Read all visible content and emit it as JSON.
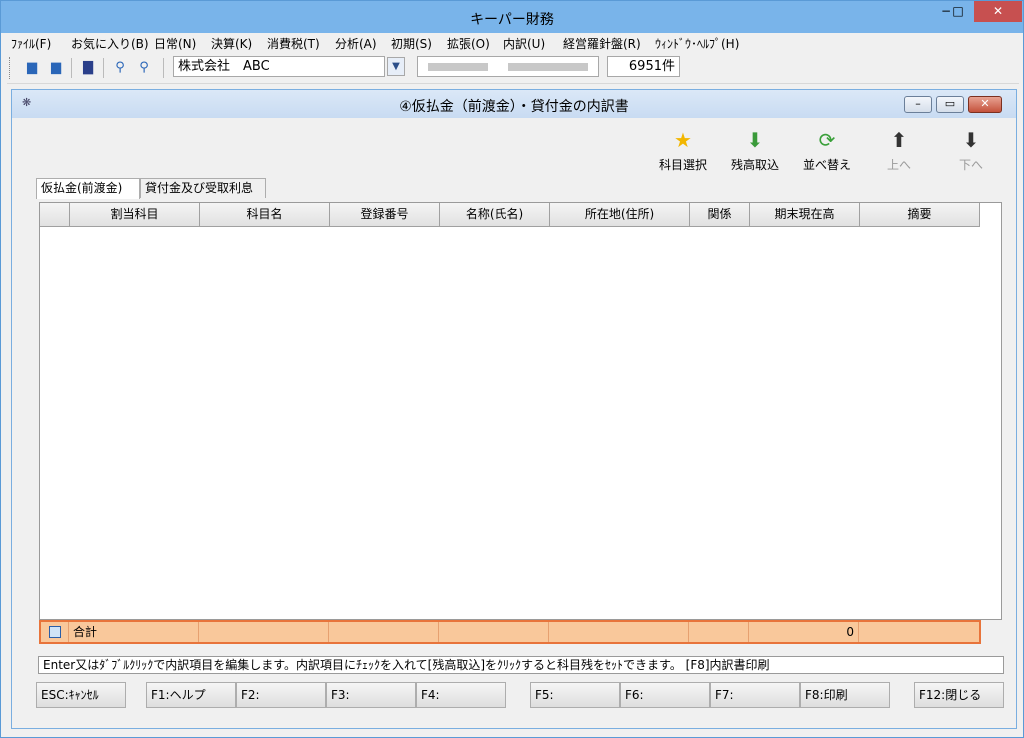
{
  "window": {
    "title": "キーパー財務",
    "min_label": "−",
    "max_label": "□",
    "close_label": "✕"
  },
  "menu": [
    "ﾌｧｲﾙ(F)",
    "お気に入り(B)",
    "日常(N)",
    "決算(K)",
    "消費税(T)",
    "分析(A)",
    "初期(S)",
    "拡張(O)",
    "内訳(U)",
    "経営羅針盤(R)",
    "ｳｨﾝﾄﾞｳ･ﾍﾙﾌﾟ(H)"
  ],
  "toolbar": {
    "company": "株式会社　ABC",
    "count": "6951件"
  },
  "child": {
    "title": "④仮払金（前渡金）・貸付金の内訳書"
  },
  "actions": [
    {
      "label": "科目選択",
      "enabled": true
    },
    {
      "label": "残高取込",
      "enabled": true
    },
    {
      "label": "並べ替え",
      "enabled": true
    },
    {
      "label": "上へ",
      "enabled": false
    },
    {
      "label": "下へ",
      "enabled": false
    }
  ],
  "tabs": [
    "仮払金(前渡金)",
    "貸付金及び受取利息"
  ],
  "columns": [
    "",
    "割当科目",
    "科目名",
    "登録番号",
    "名称(氏名)",
    "所在地(住所)",
    "関係",
    "期末現在高",
    "摘要"
  ],
  "total": {
    "label": "合計",
    "amount": "0"
  },
  "status_text": "Enter又はﾀﾞﾌﾞﾙｸﾘｯｸで内訳項目を編集します。内訳項目にﾁｪｯｸを入れて[残高取込]をｸﾘｯｸすると科目残をｾｯﾄできます。 [F8]内訳書印刷",
  "fkeys": [
    "ESC:ｷｬﾝｾﾙ",
    "F1:ヘルプ",
    "F2:",
    "F3:",
    "F4:",
    "F5:",
    "F6:",
    "F7:",
    "F8:印刷",
    "F12:閉じる"
  ]
}
